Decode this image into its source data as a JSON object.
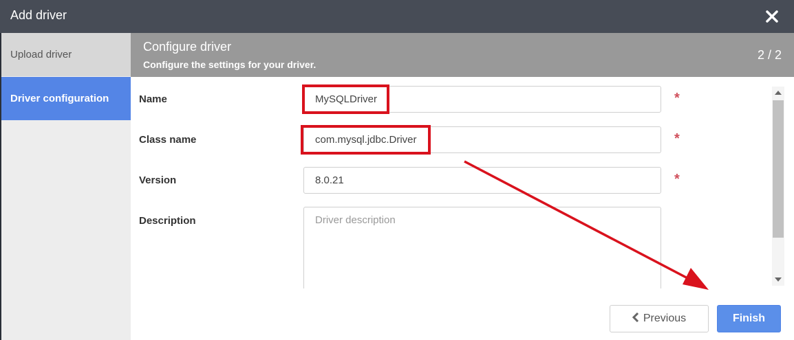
{
  "dialog": {
    "title": "Add driver"
  },
  "sidebar": {
    "items": [
      {
        "label": "Upload driver"
      },
      {
        "label": "Driver configuration"
      }
    ]
  },
  "header": {
    "title": "Configure driver",
    "subtitle": "Configure the settings for your driver.",
    "step": "2 / 2"
  },
  "form": {
    "name": {
      "label": "Name",
      "value": "MySQLDriver",
      "required": "*"
    },
    "class_name": {
      "label": "Class name",
      "value": "com.mysql.jdbc.Driver",
      "required": "*"
    },
    "version": {
      "label": "Version",
      "value": "8.0.21",
      "required": "*"
    },
    "description": {
      "label": "Description",
      "placeholder": "Driver description"
    }
  },
  "footer": {
    "previous_label": "Previous",
    "finish_label": "Finish"
  },
  "colors": {
    "titlebar": "#474c56",
    "header": "#999999",
    "active_nav": "#5485e6",
    "primary_button": "#5b8fe9",
    "highlight": "#d9121d",
    "required": "#d0505c"
  }
}
